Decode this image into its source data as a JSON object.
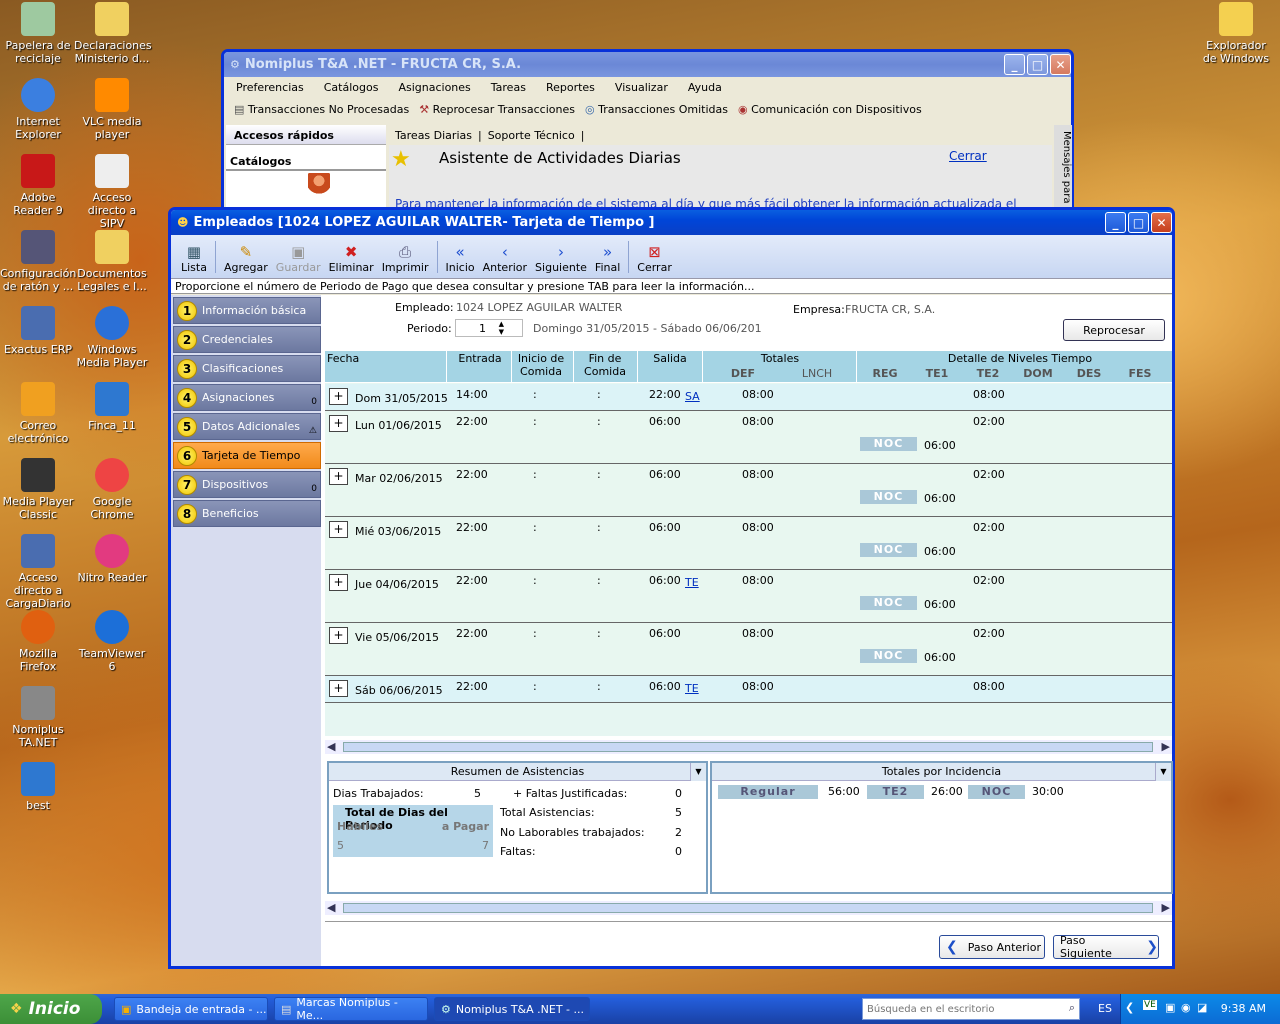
{
  "desktop": {
    "icons": [
      {
        "label": "Papelera de reciclaje",
        "icon": "recycle-bin-icon"
      },
      {
        "label": "Declaraciones Ministerio d...",
        "icon": "folder-icon"
      },
      {
        "label": "Internet Explorer",
        "icon": "ie-icon"
      },
      {
        "label": "VLC media player",
        "icon": "vlc-icon"
      },
      {
        "label": "Adobe Reader 9",
        "icon": "adobe-icon"
      },
      {
        "label": "Acceso directo a SIPV",
        "icon": "shortcut-icon"
      },
      {
        "label": "Configuración de ratón y ...",
        "icon": "mouse-icon"
      },
      {
        "label": "Documentos Legales e I...",
        "icon": "folder-icon"
      },
      {
        "label": "Exactus ERP",
        "icon": "erp-icon"
      },
      {
        "label": "Windows Media Player",
        "icon": "wmp-icon"
      },
      {
        "label": "Correo electrónico",
        "icon": "mail-icon"
      },
      {
        "label": "Finca_11",
        "icon": "grid-icon"
      },
      {
        "label": "Media Player Classic",
        "icon": "mpc-icon"
      },
      {
        "label": "Google Chrome",
        "icon": "chrome-icon"
      },
      {
        "label": "Acceso directo a CargaDiario",
        "icon": "erp-icon"
      },
      {
        "label": "Nitro Reader",
        "icon": "nitro-icon"
      },
      {
        "label": "Mozilla Firefox",
        "icon": "firefox-icon"
      },
      {
        "label": "TeamViewer 6",
        "icon": "teamviewer-icon"
      },
      {
        "label": "Nomiplus TA.NET",
        "icon": "nomiplus-icon"
      },
      {
        "label": "best",
        "icon": "grid-icon"
      },
      {
        "label": "Explorador de Windows",
        "icon": "explorer-icon"
      }
    ]
  },
  "back_window": {
    "title": "Nomiplus T&A .NET - FRUCTA CR, S.A.",
    "menu": [
      "Preferencias",
      "Catálogos",
      "Asignaciones",
      "Tareas",
      "Reportes",
      "Visualizar",
      "Ayuda"
    ],
    "toolbar": [
      "Transacciones No Procesadas",
      "Reprocesar Transacciones",
      "Transacciones Omitidas",
      "Comunicación con Dispositivos"
    ],
    "quick_access": "Accesos rápidos",
    "catalogs": "Catálogos",
    "tabs": [
      "Tareas Diarias",
      "Soporte Técnico"
    ],
    "wizard_title": "Asistente de Actividades Diarias",
    "close_link": "Cerrar",
    "wizard_text": "Para mantener la información de el sistema al día y que más fácil obtener la información actualizada el",
    "side_label": "Mensajes para"
  },
  "emp_window": {
    "title": "Empleados [1024 LOPEZ AGUILAR WALTER- Tarjeta de Tiempo ]",
    "toolbar": {
      "lista": "Lista",
      "agregar": "Agregar",
      "guardar": "Guardar",
      "eliminar": "Eliminar",
      "imprimir": "Imprimir",
      "inicio": "Inicio",
      "anterior": "Anterior",
      "siguiente": "Siguiente",
      "final": "Final",
      "cerrar": "Cerrar"
    },
    "hint": "Proporcione el número de Periodo de Pago que desea consultar y presione TAB para leer la información...",
    "sidebar": [
      {
        "n": "1",
        "label": "Información básica",
        "badge": ""
      },
      {
        "n": "2",
        "label": "Credenciales",
        "badge": ""
      },
      {
        "n": "3",
        "label": "Clasificaciones",
        "badge": ""
      },
      {
        "n": "4",
        "label": "Asignaciones",
        "badge": "0"
      },
      {
        "n": "5",
        "label": "Datos Adicionales",
        "badge": "⚠"
      },
      {
        "n": "6",
        "label": "Tarjeta de Tiempo",
        "badge": ""
      },
      {
        "n": "7",
        "label": "Dispositivos",
        "badge": "0"
      },
      {
        "n": "8",
        "label": "Beneficios",
        "badge": ""
      }
    ],
    "header": {
      "empleado_label": "Empleado:",
      "empleado_value": "1024 LOPEZ AGUILAR WALTER",
      "empresa_label": "Empresa:",
      "empresa_value": "FRUCTA CR, S.A.",
      "periodo_label": "Periodo:",
      "periodo_value": "1",
      "periodo_range": "Domingo 31/05/2015 - Sábado 06/06/201",
      "reprocesar": "Reprocesar"
    },
    "grid_headers": {
      "fecha": "Fecha",
      "entrada": "Entrada",
      "inicio_comida": "Inicio de Comida",
      "fin_comida": "Fin de Comida",
      "salida": "Salida",
      "totales": "Totales",
      "def": "DEF",
      "lnch": "LNCH",
      "detalle": "Detalle de Niveles Tiempo",
      "reg": "REG",
      "te1": "TE1",
      "te2": "TE2",
      "dom": "DOM",
      "des": "DES",
      "fes": "FES"
    },
    "rows": [
      {
        "fecha": "Dom 31/05/2015",
        "entrada": "14:00",
        "ic": ":",
        "fc": ":",
        "salida": "22:00",
        "tag": "SA",
        "def": "08:00",
        "te2": "08:00",
        "noc": "",
        "noc_val": ""
      },
      {
        "fecha": "Lun 01/06/2015",
        "entrada": "22:00",
        "ic": ":",
        "fc": ":",
        "salida": "06:00",
        "tag": "",
        "def": "08:00",
        "te2": "02:00",
        "noc": "NOC",
        "noc_val": "06:00"
      },
      {
        "fecha": "Mar 02/06/2015",
        "entrada": "22:00",
        "ic": ":",
        "fc": ":",
        "salida": "06:00",
        "tag": "",
        "def": "08:00",
        "te2": "02:00",
        "noc": "NOC",
        "noc_val": "06:00"
      },
      {
        "fecha": "Mié 03/06/2015",
        "entrada": "22:00",
        "ic": ":",
        "fc": ":",
        "salida": "06:00",
        "tag": "",
        "def": "08:00",
        "te2": "02:00",
        "noc": "NOC",
        "noc_val": "06:00"
      },
      {
        "fecha": "Jue 04/06/2015",
        "entrada": "22:00",
        "ic": ":",
        "fc": ":",
        "salida": "06:00",
        "tag": "TE",
        "def": "08:00",
        "te2": "02:00",
        "noc": "NOC",
        "noc_val": "06:00"
      },
      {
        "fecha": "Vie 05/06/2015",
        "entrada": "22:00",
        "ic": ":",
        "fc": ":",
        "salida": "06:00",
        "tag": "",
        "def": "08:00",
        "te2": "02:00",
        "noc": "NOC",
        "noc_val": "06:00"
      },
      {
        "fecha": "Sáb 06/06/2015",
        "entrada": "22:00",
        "ic": ":",
        "fc": ":",
        "salida": "06:00",
        "tag": "TE",
        "def": "08:00",
        "te2": "08:00",
        "noc": "",
        "noc_val": ""
      }
    ],
    "resumen": {
      "title": "Resumen de Asistencias",
      "dias_trabajados_label": "Dias Trabajados:",
      "dias_trabajados": "5",
      "faltas_just_label": "+ Faltas Justificadas:",
      "faltas_just": "0",
      "total_dias_label": "Total de Dias del Periodo",
      "habiles_label": "Hábiles",
      "a_pagar_label": "a Pagar",
      "habiles": "5",
      "a_pagar": "7",
      "total_asist_label": "Total Asistencias:",
      "total_asist": "5",
      "no_lab_label": "No Laborables trabajados:",
      "no_lab": "2",
      "faltas_label": "Faltas:",
      "faltas": "0"
    },
    "totales_incidencia": {
      "title": "Totales por Incidencia",
      "items": [
        {
          "label": "Regular",
          "value": "56:00"
        },
        {
          "label": "TE2",
          "value": "26:00"
        },
        {
          "label": "NOC",
          "value": "30:00"
        }
      ]
    },
    "nav": {
      "prev": "Paso Anterior",
      "next": "Paso Siguiente"
    }
  },
  "taskbar": {
    "start": "Inicio",
    "tasks": [
      "Bandeja de entrada - ...",
      "Marcas Nomiplus - Me...",
      "Nomiplus T&A .NET - ..."
    ],
    "search_placeholder": "Búsqueda en el escritorio",
    "lang": "ES",
    "clock": "9:38 AM"
  }
}
